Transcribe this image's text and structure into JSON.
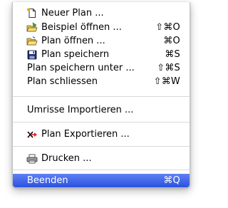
{
  "menu": {
    "items": [
      {
        "label": "Neuer Plan ...",
        "shortcut": "",
        "icon": "new-document-icon"
      },
      {
        "label": "Beispiel öffnen ...",
        "shortcut": "⇧⌘O",
        "icon": "open-example-icon"
      },
      {
        "label": "Plan öffnen ...",
        "shortcut": "⌘O",
        "icon": "open-folder-icon"
      },
      {
        "label": "Plan speichern",
        "shortcut": "⌘S",
        "icon": "floppy-disk-icon"
      },
      {
        "label": "Plan speichern unter ...",
        "shortcut": "⇧⌘S",
        "icon": ""
      },
      {
        "label": "Plan schliessen",
        "shortcut": "⇧⌘W",
        "icon": ""
      },
      {
        "label": "Umrisse Importieren ...",
        "shortcut": "",
        "icon": ""
      },
      {
        "label": "Plan Exportieren ...",
        "shortcut": "",
        "icon": "export-icon"
      },
      {
        "label": "Drucken ...",
        "shortcut": "",
        "icon": "printer-icon"
      },
      {
        "label": "Beenden",
        "shortcut": "⌘Q",
        "icon": "",
        "highlighted": true
      }
    ]
  },
  "colors": {
    "highlight": "#3a62ea",
    "separator": "#d9d9d9"
  }
}
